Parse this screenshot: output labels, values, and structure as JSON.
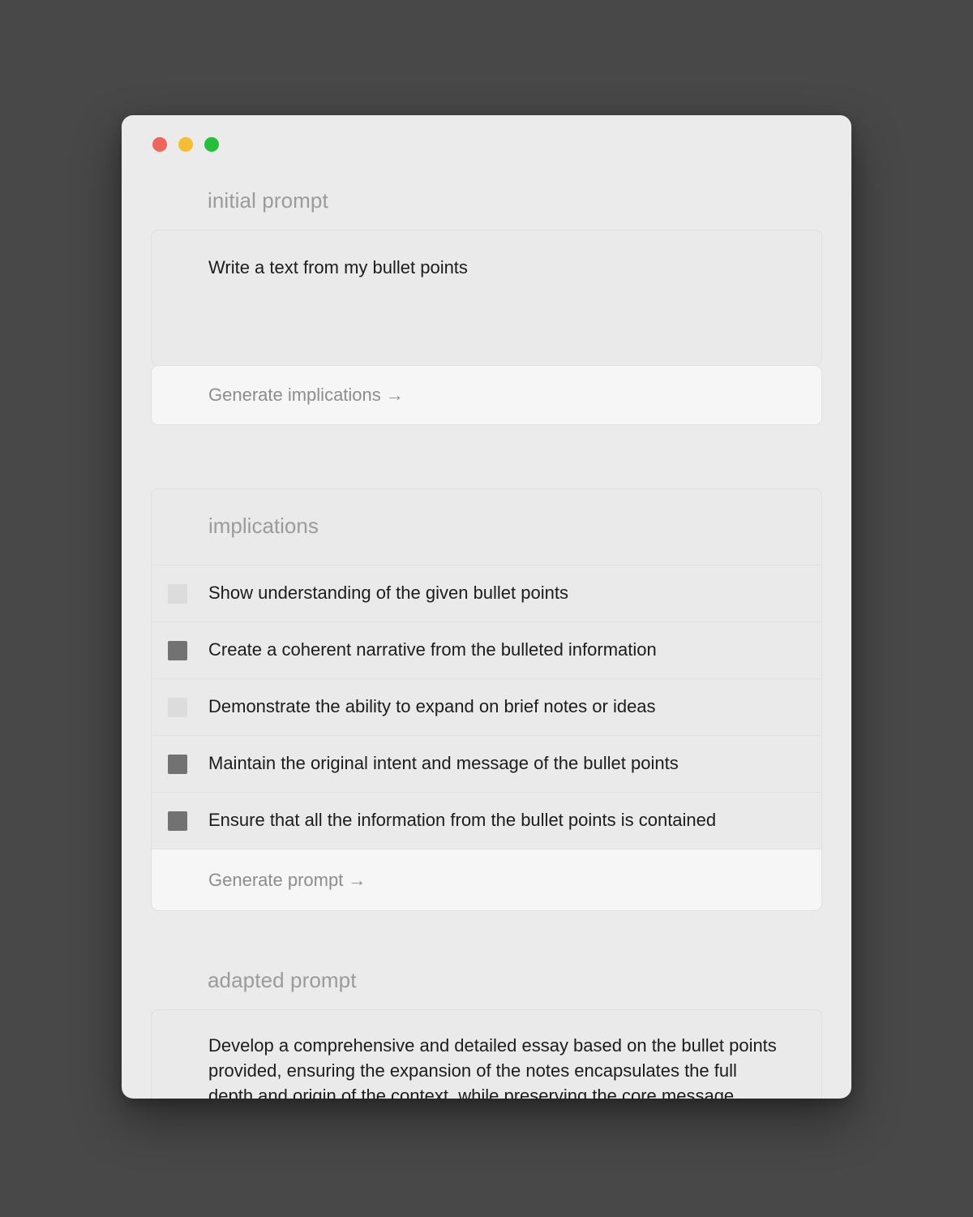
{
  "window": {
    "traffic_lights": [
      {
        "name": "close",
        "color": "#f0645c"
      },
      {
        "name": "minimize",
        "color": "#f6bd33"
      },
      {
        "name": "zoom",
        "color": "#25c03a"
      }
    ]
  },
  "initial_prompt": {
    "label": "initial prompt",
    "value": "Write a text from my bullet points",
    "action_label": "Generate implications →"
  },
  "implications": {
    "label": "implications",
    "items": [
      {
        "text": "Show understanding of the given bullet points",
        "checked": false
      },
      {
        "text": "Create a coherent narrative from the bulleted information",
        "checked": true
      },
      {
        "text": "Demonstrate the ability to expand on brief notes or ideas",
        "checked": false
      },
      {
        "text": "Maintain the original intent and message of the bullet points",
        "checked": true
      },
      {
        "text": "Ensure that all the information from the bullet points is contained",
        "checked": true
      }
    ],
    "action_label": "Generate prompt →"
  },
  "adapted_prompt": {
    "label": "adapted prompt",
    "value": "Develop a comprehensive and detailed essay based on the bullet points provided, ensuring the expansion of the notes encapsulates the full depth and origin of the context, while preserving the core message."
  },
  "colors": {
    "page_background": "#484848",
    "window_background": "#ebebeb",
    "card_background": "#eaeaea",
    "button_background": "#f6f6f6",
    "border": "#dfdfdf",
    "label_text": "#9b9b9b",
    "body_text": "#1c1c1c",
    "checkbox_off": "#dcdcdc",
    "checkbox_on": "#727272"
  }
}
